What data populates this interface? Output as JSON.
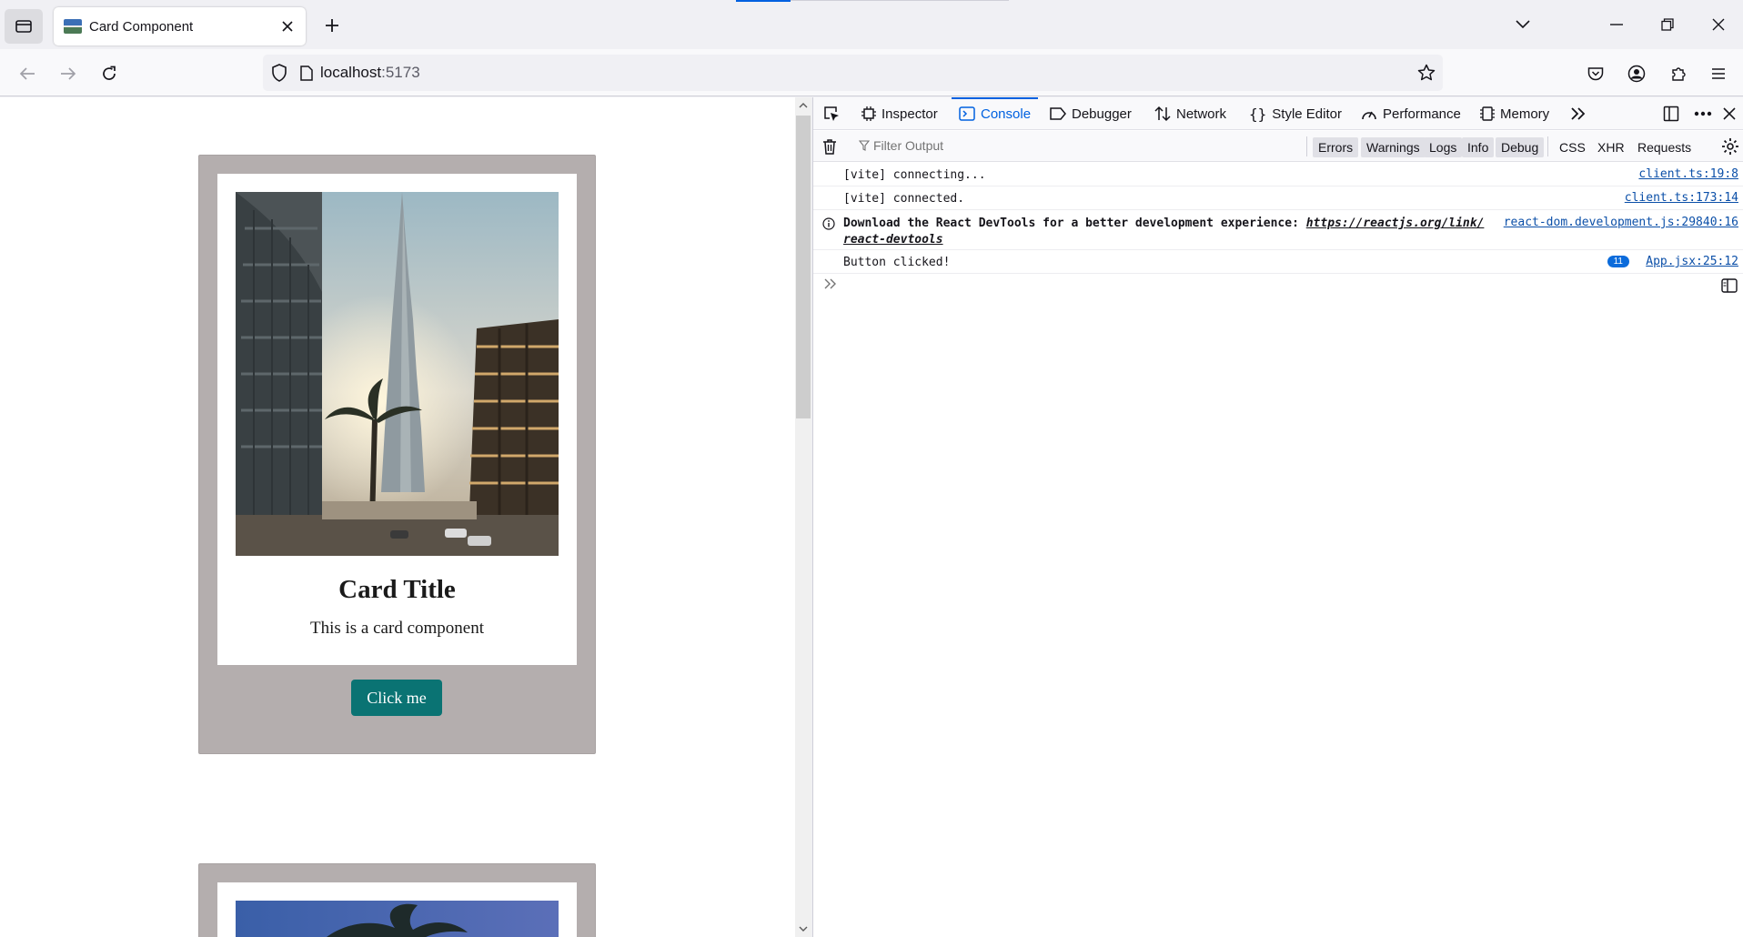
{
  "browser": {
    "tab": {
      "title": "Card Component"
    },
    "url": {
      "host": "localhost",
      "port": ":5173"
    }
  },
  "page": {
    "cards": [
      {
        "title": "Card Title",
        "text": "This is a card component",
        "button": "Click me"
      },
      {
        "title": "",
        "text": "",
        "button": ""
      }
    ]
  },
  "devtools": {
    "tabs": [
      {
        "label": "Inspector",
        "icon": "inspector-icon"
      },
      {
        "label": "Console",
        "icon": "console-icon"
      },
      {
        "label": "Debugger",
        "icon": "debugger-icon"
      },
      {
        "label": "Network",
        "icon": "network-icon"
      },
      {
        "label": "Style Editor",
        "icon": "style-editor-icon"
      },
      {
        "label": "Performance",
        "icon": "performance-icon"
      },
      {
        "label": "Memory",
        "icon": "memory-icon"
      }
    ],
    "active_tab": "Console",
    "filter_placeholder": "Filter Output",
    "levels": [
      "Errors",
      "Warnings",
      "Logs",
      "Info",
      "Debug"
    ],
    "types": [
      "CSS",
      "XHR",
      "Requests"
    ],
    "messages": [
      {
        "text": "[vite] connecting...",
        "source": "client.ts:19:8"
      },
      {
        "text": "[vite] connected.",
        "source": "client.ts:173:14"
      },
      {
        "text_before": "Download the React DevTools for a better development experience: ",
        "link": "https://reactjs.org/link/react-devtools",
        "source": "react-dom.development.js:29840:16"
      },
      {
        "text": "Button clicked!",
        "count": "11",
        "source": "App.jsx:25:12"
      }
    ]
  },
  "colors": {
    "accent": "#0061e0",
    "card_bg": "#b4aeae",
    "button_bg": "#0a7373"
  }
}
